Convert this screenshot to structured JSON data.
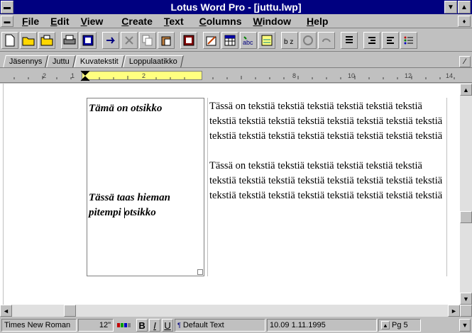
{
  "window": {
    "title": "Lotus Word Pro - [juttu.lwp]"
  },
  "menu": [
    "File",
    "Edit",
    "View",
    "Create",
    "Text",
    "Columns",
    "Window",
    "Help"
  ],
  "tabs": [
    "Jäsennys",
    "Juttu",
    "Kuvatekstit",
    "Loppulaatikko"
  ],
  "ruler": {
    "labels": [
      "2",
      "1",
      "2",
      "8",
      "10",
      "12",
      "14"
    ]
  },
  "document": {
    "heading1": "Tämä on otsikko",
    "heading2_line1": "Tässä taas hieman",
    "heading2_line2a": "pitempi ",
    "heading2_line2b": "otsikko",
    "para1": "Tässä on tekstiä tekstiä tekstiä tekstiä tekstiä tekstiä tekstiä tekstiä tekstiä tekstiä tekstiä tekstiä tekstiä tekstiä tekstiä tekstiä tekstiä tekstiä tekstiä tekstiä tekstiä tekstiä",
    "para2": "Tässä on tekstiä tekstiä tekstiä tekstiä tekstiä tekstiä tekstiä tekstiä tekstiä tekstiä tekstiä tekstiä tekstiä tekstiä tekstiä tekstiä tekstiä tekstiä tekstiä tekstiä tekstiä tekstiä"
  },
  "status": {
    "font": "Times New Roman",
    "size": "12\"",
    "bold": "B",
    "italic": "I",
    "underline": "U",
    "style": "Default Text",
    "datetime": "10.09  1.11.1995",
    "page": "Pg 5"
  }
}
